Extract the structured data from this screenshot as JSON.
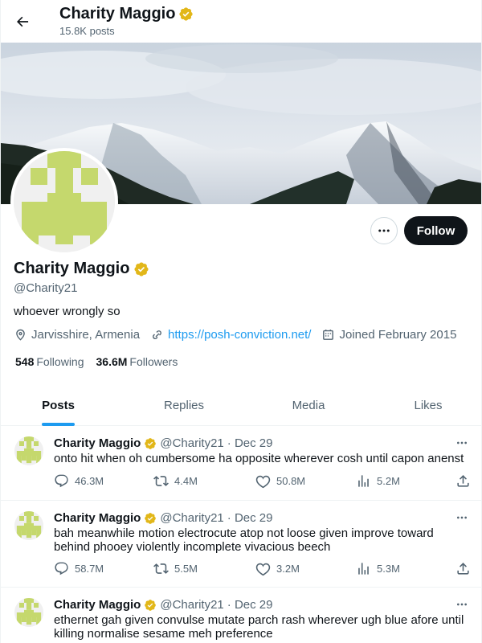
{
  "header": {
    "title": "Charity Maggio",
    "posts_count": "15.8K posts"
  },
  "profile": {
    "name": "Charity Maggio",
    "handle": "@Charity21",
    "bio": "whoever wrongly so",
    "location": "Jarvisshire, Armenia",
    "url": "https://posh-conviction.net/",
    "joined": "Joined February 2015",
    "following_count": "548",
    "following_label": "Following",
    "followers_count": "36.6M",
    "followers_label": "Followers",
    "follow_label": "Follow"
  },
  "tabs": [
    {
      "label": "Posts",
      "active": true
    },
    {
      "label": "Replies",
      "active": false
    },
    {
      "label": "Media",
      "active": false
    },
    {
      "label": "Likes",
      "active": false
    }
  ],
  "posts": [
    {
      "name": "Charity Maggio",
      "handle": "@Charity21",
      "date": "· Dec 29",
      "text": "onto hit when oh cumbersome ha opposite wherever cosh until capon anenst",
      "replies": "46.3M",
      "reposts": "4.4M",
      "likes": "50.8M",
      "views": "5.2M"
    },
    {
      "name": "Charity Maggio",
      "handle": "@Charity21",
      "date": "· Dec 29",
      "text": "bah meanwhile motion electrocute atop not loose given improve toward behind phooey violently incomplete vivacious beech",
      "replies": "58.7M",
      "reposts": "5.5M",
      "likes": "3.2M",
      "views": "5.3M"
    },
    {
      "name": "Charity Maggio",
      "handle": "@Charity21",
      "date": "· Dec 29",
      "text": "ethernet gah given convulse mutate parch rash wherever ugh blue afore until killing normalise sesame meh preference"
    }
  ],
  "colors": {
    "accent": "#1d9bf0",
    "verified_badge": "#e2b719",
    "avatar_pattern": "#c5d86d"
  },
  "icons": {
    "back": "arrow-left-icon",
    "verified": "verified-badge-icon",
    "more": "more-dots-icon",
    "location": "location-pin-icon",
    "link": "link-icon",
    "calendar": "calendar-icon",
    "reply": "reply-icon",
    "repost": "repost-icon",
    "like": "heart-icon",
    "views": "views-bar-icon",
    "share": "share-icon"
  }
}
